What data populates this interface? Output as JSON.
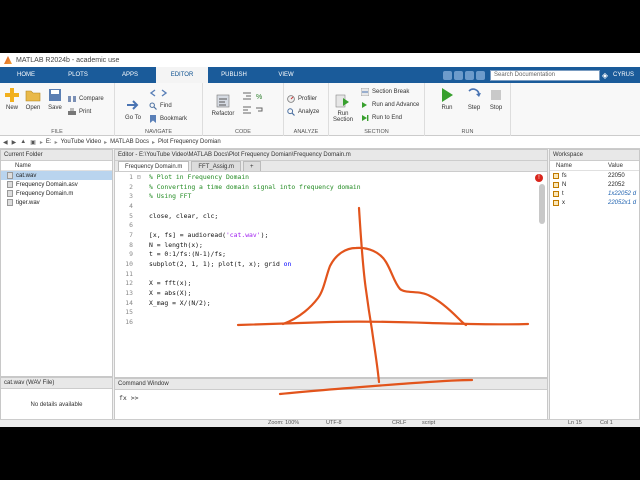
{
  "window": {
    "title": "MATLAB R2024b - academic use"
  },
  "tabs": [
    "HOME",
    "PLOTS",
    "APPS",
    "EDITOR",
    "PUBLISH",
    "VIEW"
  ],
  "active_tab": "EDITOR",
  "search": {
    "placeholder": "Search Documentation"
  },
  "user": "CYRUS",
  "ribbon": {
    "file": {
      "label": "FILE",
      "new": "New",
      "open": "Open",
      "save": "Save",
      "compare": "Compare",
      "print": "Print"
    },
    "navigate": {
      "label": "NAVIGATE",
      "goto": "Go To",
      "find": "Find",
      "bookmark": "Bookmark"
    },
    "code": {
      "label": "CODE",
      "refactor": "Refactor"
    },
    "analyze": {
      "label": "ANALYZE",
      "profiler": "Profiler",
      "analyze": "Analyze"
    },
    "section": {
      "label": "SECTION",
      "run_section": "Run Section",
      "section_break": "Section Break",
      "run_advance": "Run and Advance",
      "run_to_end": "Run to End"
    },
    "run": {
      "label": "RUN",
      "run": "Run",
      "step": "Step",
      "stop": "Stop"
    }
  },
  "address": {
    "crumbs": [
      "E:",
      "YouTube Video",
      "MATLAB Docs",
      "Plot Frequency Domian"
    ]
  },
  "current_folder": {
    "title": "Current Folder",
    "column": "Name",
    "files": [
      "cat.wav",
      "Frequency Domain.asv",
      "Frequency Domain.m",
      "tiger.wav"
    ],
    "selected": 0
  },
  "details": {
    "title": "cat.wav  (WAV File)",
    "message": "No details available"
  },
  "editor": {
    "path": "Editor - E:\\YouTube Video\\MATLAB Docs\\Plot Frequency Domian\\Frequency Domain.m",
    "tabs": [
      "Frequency Domain.m",
      "FFT_Assig.m"
    ],
    "plus": "+",
    "lines": [
      {
        "n": "1",
        "fold": "⊟",
        "text": "% Plot in Frequency Domain",
        "type": "comment"
      },
      {
        "n": "2",
        "fold": "",
        "text": "% Converting a time domain signal into frequency domain",
        "type": "comment"
      },
      {
        "n": "3",
        "fold": "",
        "text": "% Using FFT",
        "type": "comment"
      },
      {
        "n": "4",
        "fold": "",
        "text": "",
        "type": "code"
      },
      {
        "n": "5",
        "fold": "",
        "text": "close, clear, clc;",
        "type": "code"
      },
      {
        "n": "6",
        "fold": "",
        "text": "",
        "type": "code"
      },
      {
        "n": "7",
        "fold": "",
        "text": "[x, fs] = audioread(",
        "str": "'cat.wav'",
        "after": ");",
        "type": "code"
      },
      {
        "n": "8",
        "fold": "",
        "text": "N = length(x);",
        "type": "code"
      },
      {
        "n": "9",
        "fold": "",
        "text": "t = 0:1/fs:(N-1)/fs;",
        "type": "code"
      },
      {
        "n": "10",
        "fold": "",
        "text": "subplot(2, 1, 1); plot(t, x); grid ",
        "kw": "on",
        "type": "code"
      },
      {
        "n": "11",
        "fold": "",
        "text": "",
        "type": "code"
      },
      {
        "n": "12",
        "fold": "",
        "text": "X = fft(x);",
        "type": "code"
      },
      {
        "n": "13",
        "fold": "",
        "text": "X = abs(X);",
        "type": "code"
      },
      {
        "n": "14",
        "fold": "",
        "text": "X_mag = X/(N/2);",
        "type": "code"
      },
      {
        "n": "15",
        "fold": "",
        "text": "",
        "type": "code"
      },
      {
        "n": "16",
        "fold": "",
        "text": "",
        "type": "code"
      }
    ],
    "warning": "!"
  },
  "command_window": {
    "title": "Command Window",
    "prompt": "fx >>"
  },
  "workspace": {
    "title": "Workspace",
    "col_name": "Name",
    "col_value": "Value",
    "vars": [
      {
        "name": "fs",
        "value": "22050",
        "italic": false
      },
      {
        "name": "N",
        "value": "22052",
        "italic": false
      },
      {
        "name": "t",
        "value": "1x22052 d",
        "italic": true
      },
      {
        "name": "x",
        "value": "22052x1 d",
        "italic": true
      }
    ]
  },
  "status": {
    "zoom": "Zoom: 100%",
    "encoding": "UTF-8",
    "eol": "CRLF",
    "type": "script",
    "ln": "Ln  15",
    "col": "Col  1"
  },
  "annotation_color": "#e2541c"
}
